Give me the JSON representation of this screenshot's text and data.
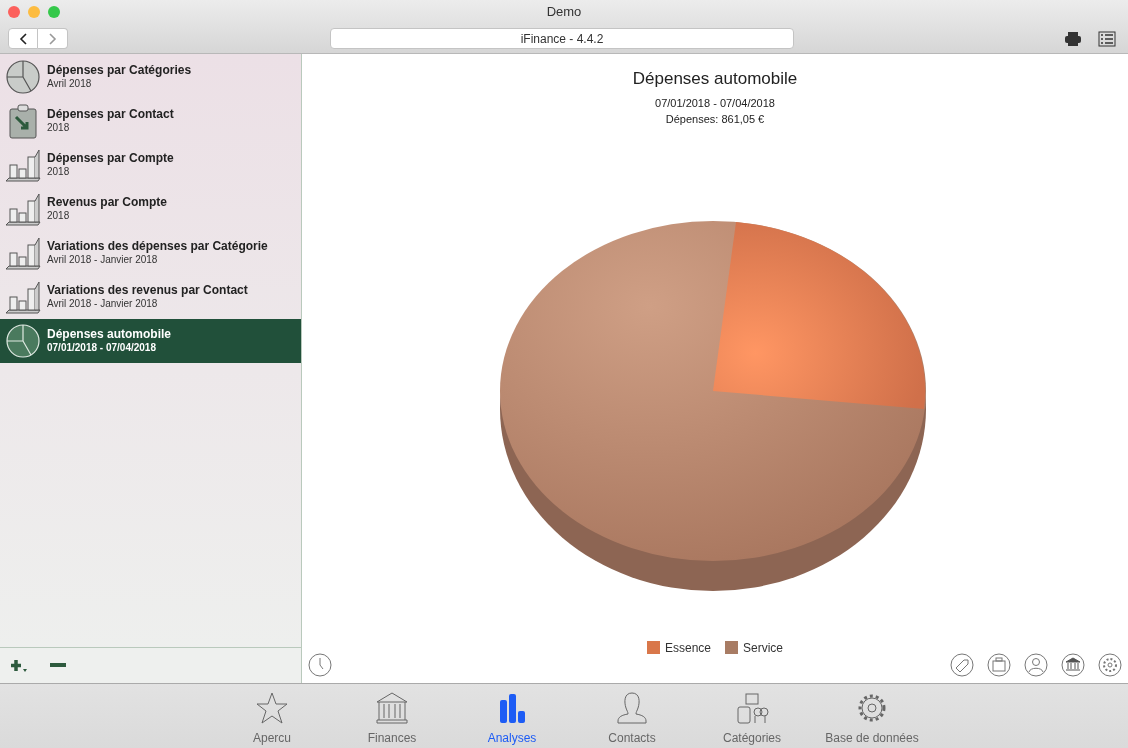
{
  "window": {
    "title": "Demo"
  },
  "toolbar": {
    "address": "iFinance - 4.4.2"
  },
  "sidebar": {
    "items": [
      {
        "title": "Dépenses par Catégories",
        "subtitle": "Avril 2018",
        "kind": "pie",
        "selected": false
      },
      {
        "title": "Dépenses par Contact",
        "subtitle": "2018",
        "kind": "clipboard",
        "selected": false
      },
      {
        "title": "Dépenses par Compte",
        "subtitle": "2018",
        "kind": "bars",
        "selected": false
      },
      {
        "title": "Revenus par Compte",
        "subtitle": "2018",
        "kind": "bars",
        "selected": false
      },
      {
        "title": "Variations des dépenses par Catégorie",
        "subtitle": "Avril 2018 - Janvier 2018",
        "kind": "bars",
        "selected": false
      },
      {
        "title": "Variations des revenus par Contact",
        "subtitle": "Avril 2018 - Janvier 2018",
        "kind": "bars",
        "selected": false
      },
      {
        "title": "Dépenses automobile",
        "subtitle": "07/01/2018 - 07/04/2018",
        "kind": "pie",
        "selected": true
      }
    ]
  },
  "report": {
    "title": "Dépenses automobile",
    "period": "07/01/2018 - 07/04/2018",
    "total": "Dépenses: 861,05 €",
    "legend": [
      {
        "label": "Essence",
        "color": "#d9774a"
      },
      {
        "label": "Service",
        "color": "#a87c64"
      }
    ]
  },
  "tabs": [
    {
      "label": "Apercu",
      "kind": "star",
      "selected": false
    },
    {
      "label": "Finances",
      "kind": "bank",
      "selected": false
    },
    {
      "label": "Analyses",
      "kind": "chart",
      "selected": true
    },
    {
      "label": "Contacts",
      "kind": "person",
      "selected": false
    },
    {
      "label": "Catégories",
      "kind": "categories",
      "selected": false
    },
    {
      "label": "Base de données",
      "kind": "gear",
      "selected": false
    }
  ]
}
